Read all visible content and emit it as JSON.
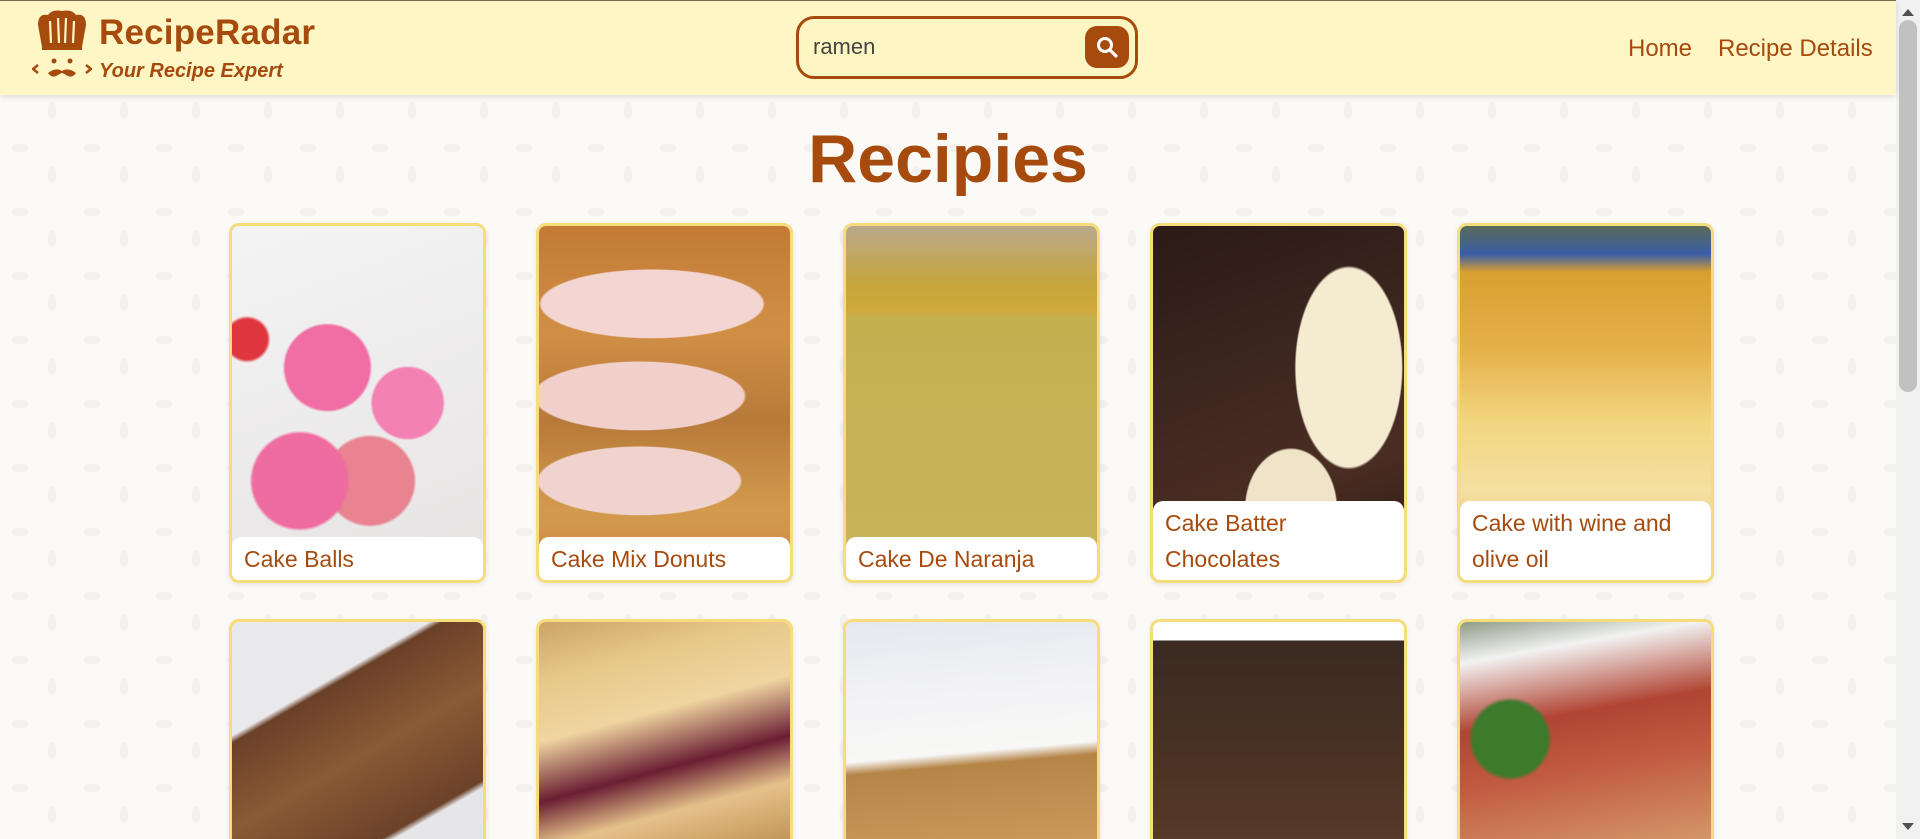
{
  "header": {
    "brand_name": "RecipeRadar",
    "brand_tagline": "Your Recipe Expert",
    "logo_icon": "chef-hat-mustache-icon",
    "search": {
      "value": "ramen",
      "button_icon": "search-icon"
    },
    "nav": {
      "home": "Home",
      "recipe_details": "Recipe Details"
    }
  },
  "main": {
    "title": "Recipies",
    "recipes": [
      {
        "title": "Cake Balls"
      },
      {
        "title": "Cake Mix Donuts"
      },
      {
        "title": "Cake De Naranja"
      },
      {
        "title": "Cake Batter Chocolates"
      },
      {
        "title": "Cake with wine and olive oil"
      },
      {
        "title": ""
      },
      {
        "title": ""
      },
      {
        "title": ""
      },
      {
        "title": ""
      },
      {
        "title": ""
      }
    ]
  },
  "colors": {
    "brand": "#a64a0e",
    "header_bg": "#fef6c4",
    "card_border": "#f6dc7a"
  }
}
